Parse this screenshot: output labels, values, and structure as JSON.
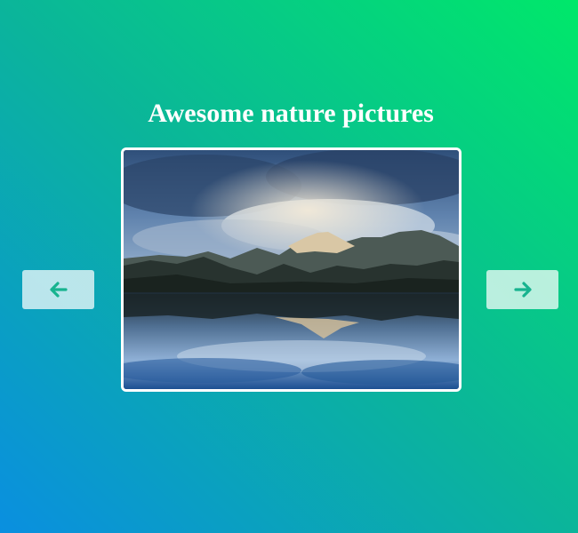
{
  "gallery": {
    "title": "Awesome nature pictures",
    "image": {
      "subject": "snow-capped mountain range reflected in a calm lake under a cloudy sky"
    },
    "prev_button": {
      "icon": "arrow-left-icon"
    },
    "next_button": {
      "icon": "arrow-right-icon"
    }
  },
  "colors": {
    "background_start": "#0a8fe0",
    "background_end": "#00e86a",
    "arrow": "#17b38f",
    "frame_border": "#ffffff"
  }
}
